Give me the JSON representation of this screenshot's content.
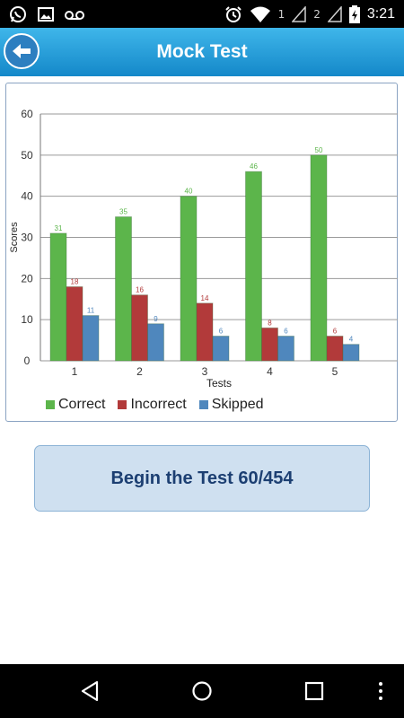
{
  "status_bar": {
    "time": "3:21",
    "sim1": "1",
    "sim2": "2",
    "icons": [
      "whatsapp-icon",
      "image-icon",
      "voicemail-icon",
      "alarm-icon",
      "wifi-icon",
      "signal-icon",
      "battery-charging-icon"
    ]
  },
  "header": {
    "title": "Mock Test",
    "back_icon": "back-arrow-icon",
    "color": "#2a9fdc"
  },
  "chart_data": {
    "type": "bar",
    "categories": [
      "1",
      "2",
      "3",
      "4",
      "5"
    ],
    "series": [
      {
        "name": "Correct",
        "values": [
          31,
          35,
          40,
          46,
          50
        ],
        "color": "#5cb54b"
      },
      {
        "name": "Incorrect",
        "values": [
          18,
          16,
          14,
          8,
          6
        ],
        "color": "#b23a3a"
      },
      {
        "name": "Skipped",
        "values": [
          11,
          9,
          6,
          6,
          4
        ],
        "color": "#4f87bd"
      }
    ],
    "xlabel": "Tests",
    "ylabel": "Scores",
    "ylim": [
      0,
      60
    ],
    "yticks": [
      0,
      10,
      20,
      30,
      40,
      50,
      60
    ],
    "grid": true,
    "legend_position": "bottom"
  },
  "begin_button": {
    "label": "Begin the Test 60/454"
  },
  "nav_bar": {
    "icons": [
      "back-nav-icon",
      "home-nav-icon",
      "recents-nav-icon",
      "overflow-menu-icon"
    ]
  }
}
